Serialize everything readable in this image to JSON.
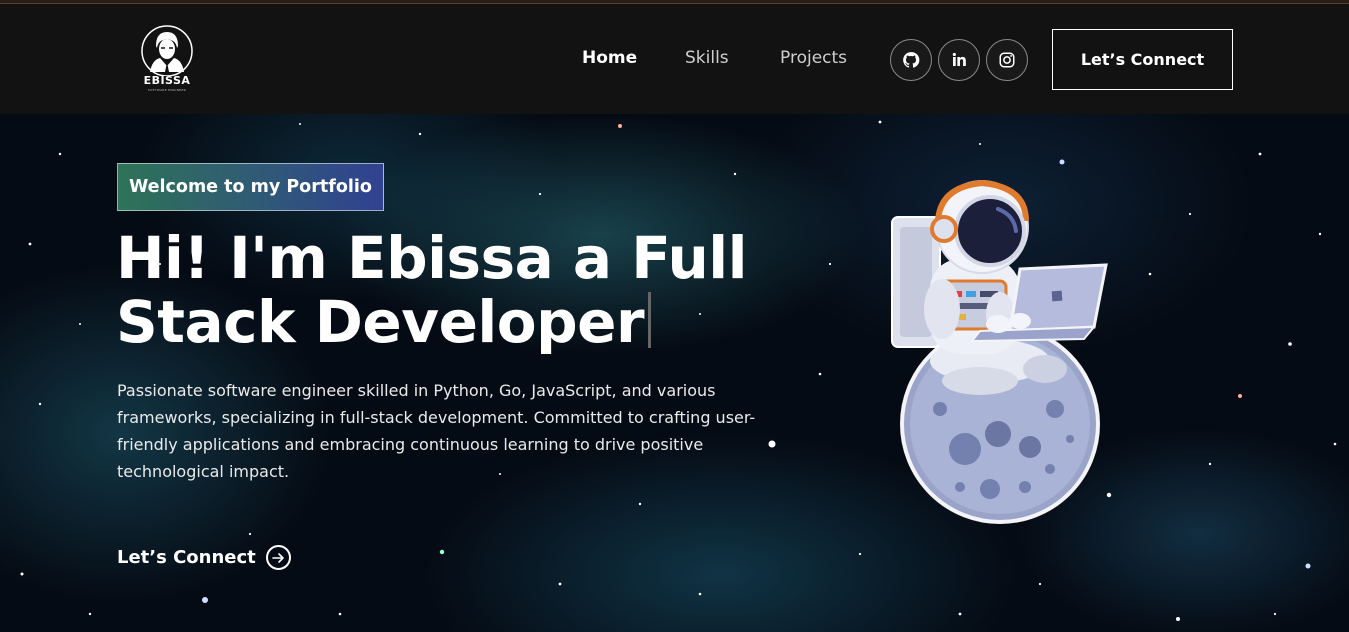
{
  "navbar": {
    "logo_text": "EBISSA",
    "logo_sub": "SOFTWARE ENGINEER",
    "links": [
      "Home",
      "Skills",
      "Projects"
    ],
    "socials": [
      "github-icon",
      "linkedin-icon",
      "instagram-icon"
    ],
    "connect_label": "Let’s Connect"
  },
  "hero": {
    "tagline": "Welcome to my Portfolio",
    "headline_line1": "Hi! I'm Ebissa a Full",
    "headline_line2": "Stack Developer",
    "description": "Passionate software engineer skilled in Python, Go, JavaScript, and various frameworks, specializing in full-stack development. Committed to crafting user-friendly applications and embracing continuous learning to drive positive technological impact.",
    "connect_label": "Let’s Connect",
    "illustration": "astronaut-on-moon-with-laptop"
  },
  "colors": {
    "navbar_bg": "#121212",
    "hero_bg": "#050b14",
    "tagline_gradient_start": "#3c966e",
    "tagline_gradient_end": "#3746a0",
    "text": "#ffffff"
  }
}
